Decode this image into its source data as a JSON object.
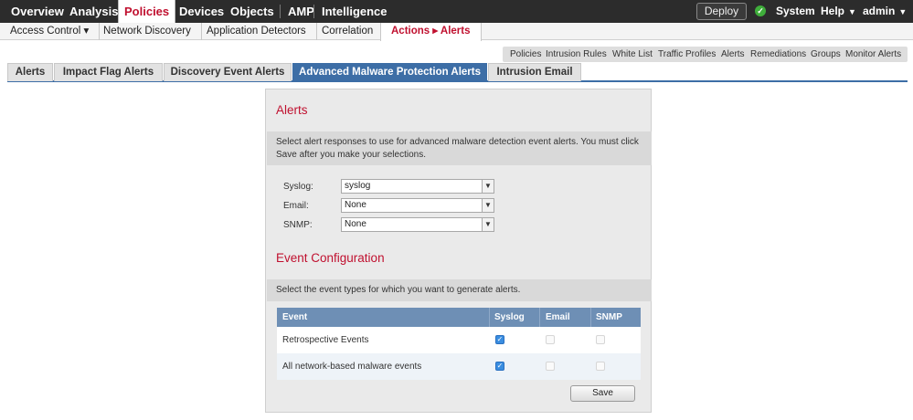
{
  "topnav": {
    "items": [
      "Overview",
      "Analysis",
      "Policies",
      "Devices",
      "Objects",
      "AMP",
      "Intelligence"
    ],
    "deploy_label": "Deploy",
    "system_label": "System",
    "help_label": "Help",
    "user_label": "admin",
    "status_color": "#3fae3b"
  },
  "subnav": {
    "items": [
      "Access Control ▾",
      "Network Discovery",
      "Application Detectors",
      "Correlation",
      "Actions ▸ Alerts"
    ]
  },
  "linkbar": {
    "items": [
      "Policies",
      "Intrusion Rules",
      "White List",
      "Traffic Profiles",
      "Alerts",
      "Remediations",
      "Groups",
      "Monitor Alerts"
    ]
  },
  "tabs": [
    "Alerts",
    "Impact Flag Alerts",
    "Discovery Event Alerts",
    "Advanced Malware Protection Alerts",
    "Intrusion Email"
  ],
  "panel": {
    "alerts_title": "Alerts",
    "alerts_desc": "Select alert responses to use for advanced malware detection event alerts. You must click Save after you make your selections.",
    "fields": [
      {
        "label": "Syslog:",
        "value": "syslog"
      },
      {
        "label": "Email:",
        "value": "None"
      },
      {
        "label": "SNMP:",
        "value": "None"
      }
    ],
    "event_title": "Event Configuration",
    "event_desc": "Select the event types for which you want to generate alerts.",
    "table": {
      "headers": [
        "Event",
        "Syslog",
        "Email",
        "SNMP"
      ],
      "rows": [
        {
          "event": "Retrospective Events",
          "syslog": true,
          "email": false,
          "snmp": false
        },
        {
          "event": "All network-based malware events",
          "syslog": true,
          "email": false,
          "snmp": false
        }
      ]
    },
    "save_label": "Save"
  },
  "colors": {
    "accent_red": "#c0102f",
    "tab_blue": "#3d6ea6",
    "table_header": "#6e8fb5",
    "checkbox_on": "#3a8de0"
  }
}
